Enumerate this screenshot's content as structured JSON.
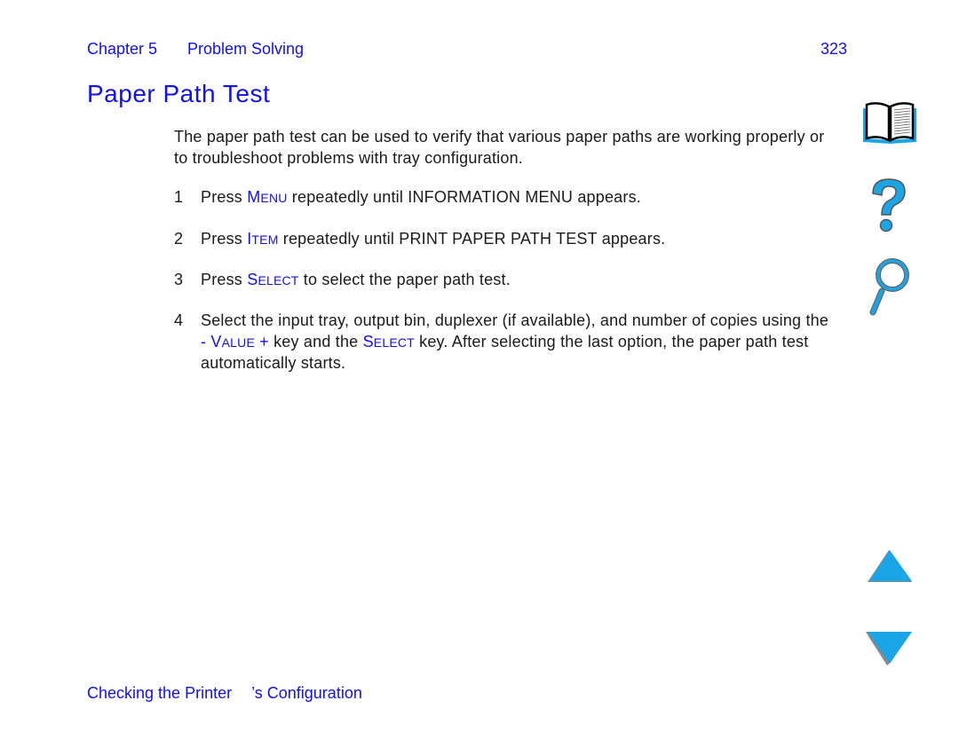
{
  "header": {
    "chapter": "Chapter 5",
    "section": "Problem Solving",
    "page_number": "323"
  },
  "title": "Paper Path Test",
  "intro": "The paper path test can be used to verify that various paper paths are working properly or to troubleshoot problems with tray configuration.",
  "steps": [
    {
      "num": "1",
      "pre": "Press ",
      "key_cap": "M",
      "key_rest": "enu",
      "post": " repeatedly until INFORMATION MENU appears."
    },
    {
      "num": "2",
      "pre": "Press ",
      "key_cap": "I",
      "key_rest": "tem",
      "post": " repeatedly until PRINT PAPER PATH TEST appears."
    },
    {
      "num": "3",
      "pre": "Press ",
      "key_cap": "S",
      "key_rest": "elect",
      "post": " to select the paper path test."
    },
    {
      "num": "4",
      "pre": "Select the input tray, output bin, duplexer (if available), and number of copies using the ",
      "key1": "- V",
      "key1_rest": "alue",
      "key1_end": " +",
      "mid": " key and the ",
      "key2_cap": "S",
      "key2_rest": "elect",
      "post": " key. After selecting the last option, the paper path test automatically starts."
    }
  ],
  "nav_icons": [
    "book-icon",
    "help-icon",
    "search-icon",
    "previous-page-icon",
    "next-page-icon"
  ],
  "footer": {
    "link_part1": "Checking the Printer",
    "link_part2": "’s Configuration"
  },
  "colors": {
    "link": "#1010f0",
    "icon": "#1aa6e6"
  }
}
